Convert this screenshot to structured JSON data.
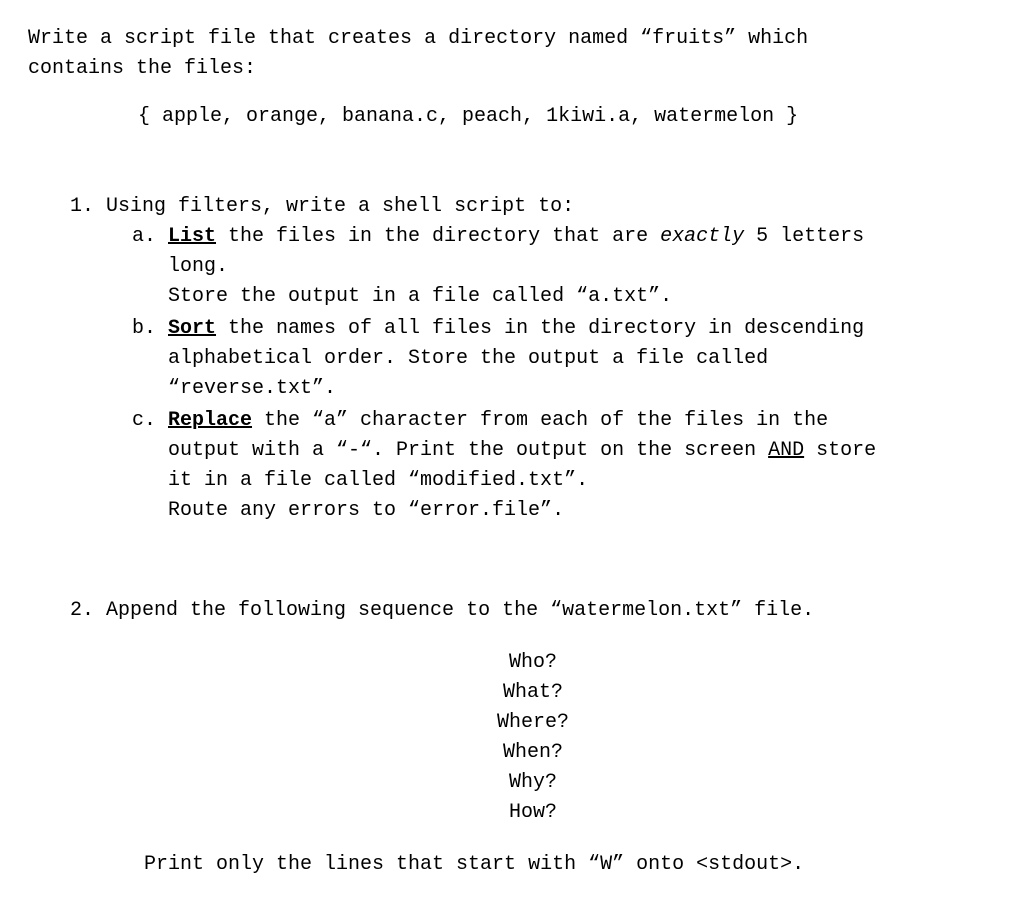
{
  "intro": {
    "l1": "Write a script file that creates a directory named “fruits” which",
    "l2": "contains the files:"
  },
  "file_set": "{ apple, orange, banana.c, peach, 1kiwi.a, watermelon }",
  "q1": {
    "lead": "1. Using filters, write a shell script to:",
    "a": {
      "marker": "a. ",
      "verb": "List",
      "rest1": " the files in the directory that are ",
      "emph": "exactly",
      "rest1b": " 5 letters",
      "cont1": "long.",
      "cont2": "Store the output in a file called “a.txt”."
    },
    "b": {
      "marker": "b. ",
      "verb": "Sort",
      "rest1": " the names of all files in the directory in descending",
      "cont1": "alphabetical order. Store the output a file called",
      "cont2": "“reverse.txt”."
    },
    "c": {
      "marker": "c. ",
      "verb": "Replace",
      "rest1": " the “a” character from each of the files in the",
      "cont1a": "output with a “-“. Print the output on the screen ",
      "and": "AND",
      "cont1b": " store",
      "cont2": "it in a file called “modified.txt”.",
      "cont3": "Route any errors to “error.file”."
    }
  },
  "q2": {
    "lead": "2. Append the following sequence to the “watermelon.txt” file.",
    "seq": [
      "Who?",
      "What?",
      "Where?",
      "When?",
      "Why?",
      "How?"
    ],
    "outro": "Print only the lines that start with “W” onto <stdout>."
  }
}
